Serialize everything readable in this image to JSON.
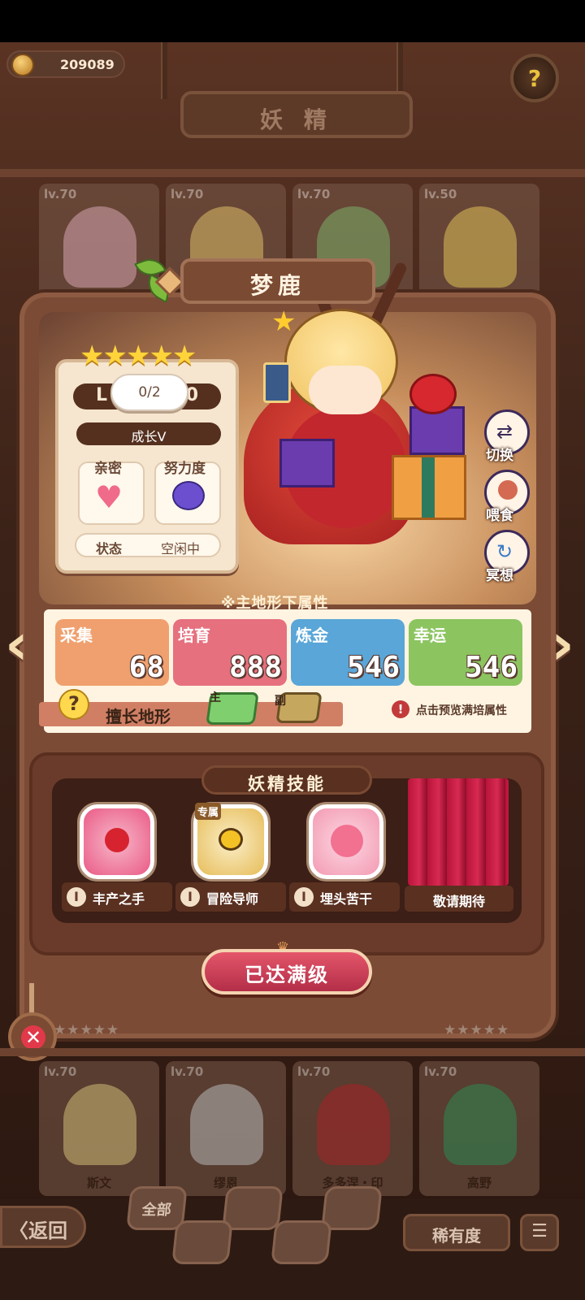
{
  "header": {
    "coins": "209089",
    "title": "妖 精",
    "help_icon": "question-icon"
  },
  "background_cards_top": [
    {
      "level": "lv.70"
    },
    {
      "level": "lv.70"
    },
    {
      "level": "lv.70"
    },
    {
      "level": "lv.50"
    }
  ],
  "background_cards_bottom": [
    {
      "level": "lv.70",
      "name": "斯文"
    },
    {
      "level": "lv.70",
      "name": "缪恩"
    },
    {
      "level": "lv.70",
      "name": "多多涅・印"
    },
    {
      "level": "lv.70",
      "name": "高野"
    }
  ],
  "sprite": {
    "name": "梦鹿",
    "stars": "★★★★★",
    "level_prefix": "L",
    "level_suffix": "0",
    "tooltip": "0/2",
    "growth": "成长V",
    "intimacy_label": "亲密",
    "effort_label": "努力度",
    "status_label": "状态",
    "status_value": "空闲中"
  },
  "side_actions": [
    {
      "label": "切换",
      "icon": "switch-icon"
    },
    {
      "label": "喂食",
      "icon": "meat-icon"
    },
    {
      "label": "冥想",
      "icon": "meditate-icon"
    }
  ],
  "attributes": {
    "caption": "※主地形下属性",
    "items": [
      {
        "label": "采集",
        "value": "68",
        "color": "#f0a06e"
      },
      {
        "label": "培育",
        "value": "888",
        "color": "#e6707e"
      },
      {
        "label": "炼金",
        "value": "546",
        "color": "#5aa6d8"
      },
      {
        "label": "幸运",
        "value": "546",
        "color": "#8cc460"
      }
    ],
    "terrain_label": "擅长地形",
    "main_tag": "主",
    "sub_tag": "副",
    "preview_hint": "点击预览满培属性"
  },
  "skills": {
    "title": "妖精技能",
    "exclusive_tag": "专属",
    "items": [
      {
        "name": "丰产之手",
        "icon": "tomato-icon"
      },
      {
        "name": "冒险导师",
        "icon": "bee-icon"
      },
      {
        "name": "埋头苦干",
        "icon": "smile-face-icon"
      }
    ],
    "coming_soon": "敬请期待",
    "info_glyph": "I"
  },
  "max_level_button": "已达满级",
  "nav": {
    "back": "〈返回",
    "filter_all": "全部",
    "rarity": "稀有度",
    "list_glyph": "☰"
  },
  "star_rows": "★★★★★"
}
